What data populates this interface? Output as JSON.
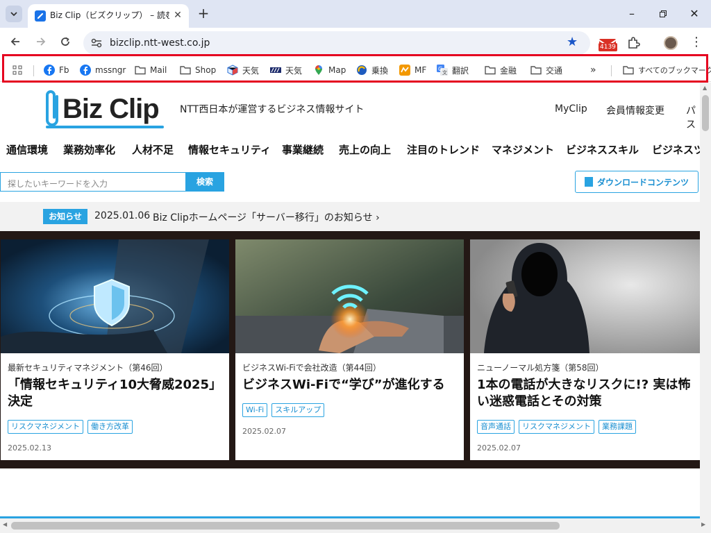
{
  "browser": {
    "tab_title": "Biz Clip（ビズクリップ） – 読む・知",
    "url": "bizclip.ntt-west.co.jp",
    "extension_badge": "4139",
    "bookmarks": [
      {
        "label": "Fb",
        "icon": "facebook-icon"
      },
      {
        "label": "mssngr",
        "icon": "facebook-icon"
      },
      {
        "label": "Mail",
        "icon": "folder-icon"
      },
      {
        "label": "Shop",
        "icon": "folder-icon"
      },
      {
        "label": "天気",
        "icon": "weather-cube-icon"
      },
      {
        "label": "天気",
        "icon": "weather-logo-icon"
      },
      {
        "label": "Map",
        "icon": "map-pin-icon"
      },
      {
        "label": "乗換",
        "icon": "transit-icon"
      },
      {
        "label": "MF",
        "icon": "mf-icon"
      },
      {
        "label": "翻訳",
        "icon": "translate-icon"
      },
      {
        "label": "金融",
        "icon": "folder-icon"
      },
      {
        "label": "交通",
        "icon": "folder-icon"
      }
    ],
    "all_bookmarks": "すべてのブックマーク"
  },
  "site": {
    "logo_text": "Biz Clip",
    "tagline": "NTT西日本が運営するビジネス情報サイト",
    "top_links": [
      "MyClip",
      "会員情報変更",
      "パス"
    ],
    "categories": [
      "通信環境",
      "業務効率化",
      "人材不足",
      "情報セキュリティ",
      "事業継続",
      "売上の向上",
      "注目のトレンド",
      "マネジメント",
      "ビジネススキル",
      "ビジネスツ"
    ],
    "search": {
      "placeholder": "探したいキーワードを入力",
      "button": "検索"
    },
    "download_button": "ダウンロードコンテンツ",
    "news": {
      "label": "お知らせ",
      "date": "2025.01.06",
      "text": "Biz Clipホームページ「サーバー移行」のお知らせ ›"
    }
  },
  "cards": [
    {
      "series": "最新セキュリティマネジメント（第46回）",
      "title": "「情報セキュリティ10大脅威2025」決定",
      "tags": [
        "リスクマネジメント",
        "働き方改革"
      ],
      "date": "2025.02.13",
      "image": "security-shield-image"
    },
    {
      "series": "ビジネスWi-Fiで会社改造（第44回）",
      "title": "ビジネスWi-Fiで“学び”が進化する",
      "tags": [
        "Wi-Fi",
        "スキルアップ"
      ],
      "date": "2025.02.07",
      "image": "wifi-hand-image"
    },
    {
      "series": "ニューノーマル処方箋（第58回）",
      "title": "1本の電話が大きなリスクに!? 実は怖い迷惑電話とその対策",
      "tags": [
        "音声通話",
        "リスクマネジメント",
        "業務課題"
      ],
      "date": "2025.02.07",
      "image": "hooded-caller-image"
    }
  ],
  "colors": {
    "accent": "#29a3e1",
    "highlight": "#e5001f",
    "dark_band": "#231815"
  }
}
